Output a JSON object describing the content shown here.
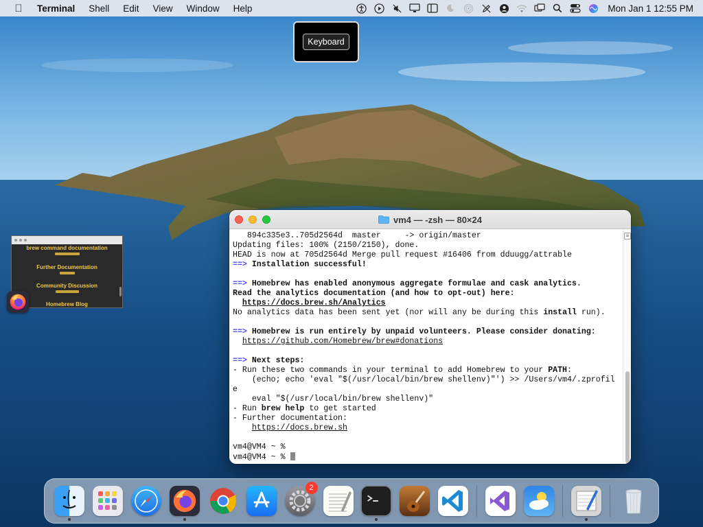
{
  "menubar": {
    "app_name": "Terminal",
    "menus": [
      "Shell",
      "Edit",
      "View",
      "Window",
      "Help"
    ],
    "status_icons": [
      "accessibility-icon",
      "play-circle-icon",
      "mute-icon",
      "display-icon",
      "sidebar-icon",
      "moon-icon",
      "airdrop-icon",
      "pencil-off-icon",
      "user-icon",
      "wifi-icon",
      "screen-mirroring-icon",
      "search-icon",
      "control-center-icon",
      "siri-icon"
    ],
    "clock": "Mon Jan 1  12:55 PM"
  },
  "keyboard_popup": {
    "label": "Keyboard"
  },
  "thumbnail": {
    "lines": [
      "brew command documentation",
      "Further Documentation",
      "Community Discussion",
      "Homebrew Blog"
    ]
  },
  "terminal": {
    "title": "vm4 — -zsh — 80×24",
    "lines": [
      [
        {
          "t": "   894c335e3..705d2564d  master     -> origin/master"
        }
      ],
      [
        {
          "t": "Updating files: 100% (2150/2150), done."
        }
      ],
      [
        {
          "t": "HEAD is now at 705d2564d Merge pull request #16406 from dduugg/attrable"
        }
      ],
      [
        {
          "t": "==>",
          "s": "arrow"
        },
        {
          "t": " Installation successful!",
          "s": "bold"
        }
      ],
      [
        {
          "t": ""
        }
      ],
      [
        {
          "t": "==>",
          "s": "arrow"
        },
        {
          "t": " Homebrew has enabled anonymous aggregate formulae and cask analytics.",
          "s": "bold"
        }
      ],
      [
        {
          "t": "Read the analytics documentation (and how to opt-out) here:",
          "s": "bold"
        }
      ],
      [
        {
          "t": "  "
        },
        {
          "t": "https://docs.brew.sh/Analytics",
          "s": "bold uline"
        }
      ],
      [
        {
          "t": "No analytics data has been sent yet (nor will any be during this "
        },
        {
          "t": "install",
          "s": "bold"
        },
        {
          "t": " run)."
        }
      ],
      [
        {
          "t": ""
        }
      ],
      [
        {
          "t": "==>",
          "s": "arrow"
        },
        {
          "t": " Homebrew is run entirely by unpaid volunteers. Please consider donating:",
          "s": "bold"
        }
      ],
      [
        {
          "t": "  "
        },
        {
          "t": "https://github.com/Homebrew/brew#donations",
          "s": "uline"
        }
      ],
      [
        {
          "t": ""
        }
      ],
      [
        {
          "t": "==>",
          "s": "arrow"
        },
        {
          "t": " Next steps:",
          "s": "bold"
        }
      ],
      [
        {
          "t": "- Run these two commands in your terminal to add Homebrew to your "
        },
        {
          "t": "PATH",
          "s": "bold"
        },
        {
          "t": ":"
        }
      ],
      [
        {
          "t": "    (echo; echo 'eval \"$(/usr/local/bin/brew shellenv)\"') >> /Users/vm4/.zprofil"
        }
      ],
      [
        {
          "t": "e"
        }
      ],
      [
        {
          "t": "    eval \"$(/usr/local/bin/brew shellenv)\""
        }
      ],
      [
        {
          "t": "- Run "
        },
        {
          "t": "brew help",
          "s": "bold"
        },
        {
          "t": " to get started"
        }
      ],
      [
        {
          "t": "- Further documentation:"
        }
      ],
      [
        {
          "t": "    "
        },
        {
          "t": "https://docs.brew.sh",
          "s": "uline"
        }
      ],
      [
        {
          "t": ""
        }
      ],
      [
        {
          "t": "vm4@VM4 ~ %"
        }
      ],
      [
        {
          "t": "vm4@VM4 ~ % "
        }
      ]
    ]
  },
  "dock": {
    "apps": [
      {
        "name": "Finder",
        "icon": "finder-icon",
        "running": true
      },
      {
        "name": "Launchpad",
        "icon": "launchpad-icon",
        "running": false
      },
      {
        "name": "Safari",
        "icon": "safari-icon",
        "running": false
      },
      {
        "name": "Firefox",
        "icon": "firefox-icon",
        "running": true
      },
      {
        "name": "Chrome",
        "icon": "chrome-icon",
        "running": false
      },
      {
        "name": "App Store",
        "icon": "app-store-icon",
        "running": false
      },
      {
        "name": "System Settings",
        "icon": "settings-icon",
        "running": false,
        "badge": "2"
      },
      {
        "name": "TextEdit",
        "icon": "textedit-icon",
        "running": false
      },
      {
        "name": "Terminal",
        "icon": "terminal-icon",
        "running": true
      },
      {
        "name": "Instruments",
        "icon": "instruments-icon",
        "running": false
      },
      {
        "name": "VS Code",
        "icon": "vscode-icon",
        "running": false
      },
      {
        "name": "Visual Studio",
        "icon": "visual-studio-icon",
        "running": false
      },
      {
        "name": "Weather",
        "icon": "weather-icon",
        "running": false
      },
      {
        "name": "Script Editor",
        "icon": "script-editor-icon",
        "running": true
      },
      {
        "name": "Trash",
        "icon": "trash-icon",
        "running": false
      }
    ]
  }
}
